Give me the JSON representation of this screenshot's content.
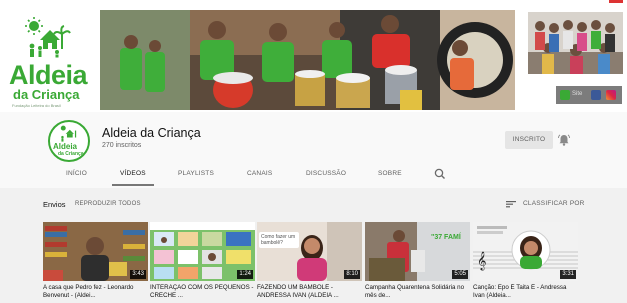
{
  "banner": {
    "logo": {
      "title": "Aldeia",
      "subtitle": "da Criança",
      "tagline": "Fundação Leiteira do Brasil"
    },
    "social": {
      "site_label": "Site",
      "links": [
        "site-icon",
        "facebook-icon",
        "instagram-icon"
      ]
    }
  },
  "channel": {
    "name": "Aldeia da Criança",
    "subscribers": "270 inscritos",
    "subscribe_label": "INSCRITO",
    "avatar_text": {
      "title": "Aldeia",
      "subtitle": "da Criança"
    }
  },
  "tabs": [
    {
      "label": "INÍCIO"
    },
    {
      "label": "VÍDEOS",
      "active": true
    },
    {
      "label": "PLAYLISTS"
    },
    {
      "label": "CANAIS"
    },
    {
      "label": "DISCUSSÃO"
    },
    {
      "label": "SOBRE"
    }
  ],
  "shelf": {
    "title": "Envios",
    "play_all": "REPRODUZIR TODOS",
    "sort_label": "CLASSIFICAR POR"
  },
  "videos": [
    {
      "title": "A casa que Pedro fez - Leonardo Benvenut - (Aldei...",
      "duration": "3:43"
    },
    {
      "title": "INTERAÇÃO COM OS PEQUENOS - CRECHE ...",
      "duration": "1:24"
    },
    {
      "title": "FAZENDO UM BAMBOLÊ - ANDRESSA IVAN (ALDEIA ...",
      "duration": "8:10",
      "overlay": "Como fazer um bambolê?"
    },
    {
      "title": "Campanha Quarentena Solidária no mês de...",
      "duration": "5:05",
      "overlay": "\"37 FAMÍ"
    },
    {
      "title": "Canção: Epo É Taita É - Andressa Ivan (Aldeia...",
      "duration": "3:31"
    }
  ],
  "colors": {
    "brand_green": "#3aa935",
    "background": "#f1f1f1",
    "header_bg": "#f9f9f9"
  }
}
